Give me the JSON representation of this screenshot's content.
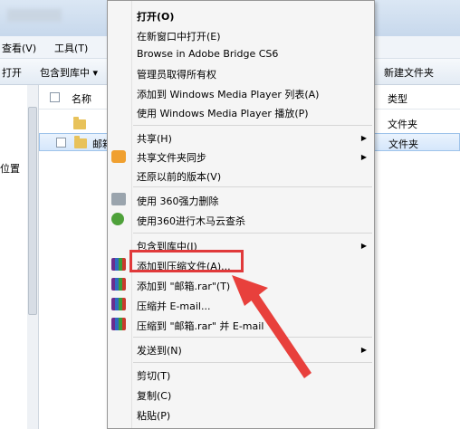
{
  "menubar": {
    "view": "查看(V)",
    "tools": "工具(T)"
  },
  "toolbar": {
    "open": "打开",
    "include_in_library": "包含到库中 ▾",
    "new_folder": "新建文件夹"
  },
  "navpane": {
    "location": "位置"
  },
  "list": {
    "col_name": "名称",
    "col_type": "类型",
    "rows": [
      {
        "name": "",
        "type": "文件夹"
      },
      {
        "name": "邮箱",
        "type": "文件夹"
      }
    ]
  },
  "context_menu": {
    "open": "打开(O)",
    "open_new_window": "在新窗口中打开(E)",
    "browse_bridge": "Browse in Adobe Bridge CS6",
    "admin_owner": "管理员取得所有权",
    "add_wmp_list": "添加到 Windows Media Player 列表(A)",
    "play_wmp": "使用 Windows Media Player 播放(P)",
    "share": "共享(H)",
    "sync_share": "共享文件夹同步",
    "restore_prev": "还原以前的版本(V)",
    "del_360": "使用 360强力删除",
    "scan_360": "使用360进行木马云查杀",
    "include_library": "包含到库中(I)",
    "add_archive": "添加到压缩文件(A)...",
    "add_rar": "添加到 \"邮箱.rar\"(T)",
    "compress_email": "压缩并 E-mail...",
    "compress_rar_email": "压缩到 \"邮箱.rar\" 并 E-mail",
    "send_to": "发送到(N)",
    "cut": "剪切(T)",
    "copy": "复制(C)",
    "paste": "粘贴(P)"
  },
  "colors": {
    "highlight_box": "#e0393a",
    "arrow": "#e8403c"
  }
}
